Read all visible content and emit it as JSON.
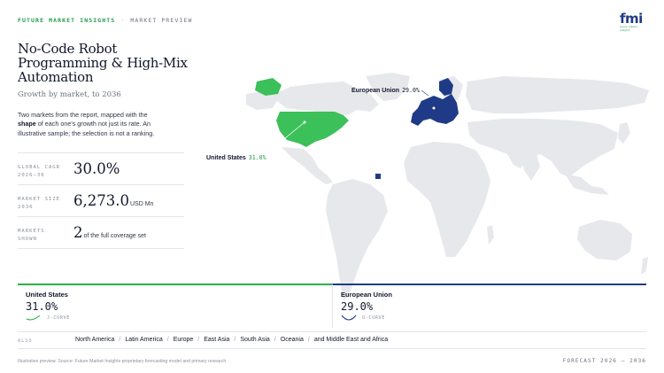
{
  "header": {
    "brand": "FUTURE MARKET INSIGHTS",
    "separator": "·",
    "section": "MARKET PREVIEW",
    "logo": "fmi",
    "logo_sub": "future market insights"
  },
  "report": {
    "title": "No-Code Robot Programming & High-Mix Automation",
    "subtitle": "Growth by market, to 2036",
    "description_pre": "Two markets from the report, mapped with the ",
    "description_bold": "shape",
    "description_post": " of each one's growth not just its rate. An illustrative sample; the selection is not a ranking."
  },
  "stats": [
    {
      "label_line1": "GLOBAL CAGR",
      "label_line2": "2026–36",
      "value": "30.0%",
      "unit": ""
    },
    {
      "label_line1": "MARKET SIZE",
      "label_line2": "2036",
      "value": "6,273.0",
      "unit": "USD Mn"
    },
    {
      "label_line1": "MARKETS",
      "label_line2": "SHOWN",
      "value": "2",
      "unit": "of the full coverage set"
    }
  ],
  "map": {
    "highlight_us_color": "#3cc05a",
    "highlight_eu_color": "#1f3b87",
    "land_color": "#e6e8ec",
    "labels": {
      "eu_name": "European Union",
      "eu_pct": "29.0%",
      "us_name": "United States",
      "us_pct": "31.0%"
    }
  },
  "cards": [
    {
      "name": "United States",
      "pct": "31.0%",
      "curve": "J-CURVE",
      "color": "#27b24a"
    },
    {
      "name": "European Union",
      "pct": "29.0%",
      "curve": "U-CURVE",
      "color": "#1f3b87"
    }
  ],
  "also": {
    "label": "ALSO",
    "regions": [
      "North America",
      "Latin America",
      "Europe",
      "East Asia",
      "South Asia",
      "Oceania",
      "and Middle East and Africa"
    ]
  },
  "footer": {
    "note": "Illustrative preview. Source: Future Market Insights proprietary forecasting model and primary research.",
    "forecast": "FORECAST 2026 – 2036"
  }
}
